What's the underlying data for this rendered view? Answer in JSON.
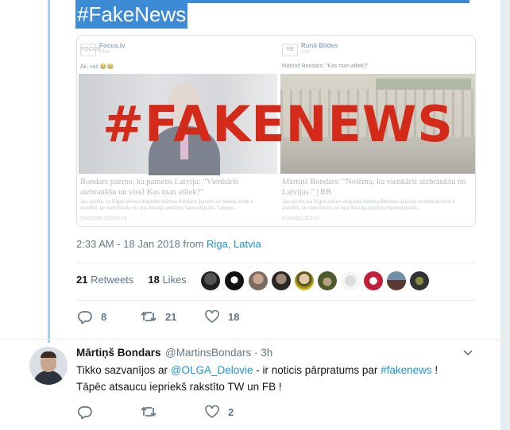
{
  "tweet_main": {
    "top_hashtag": "#FakeNews",
    "embedded_image": {
      "banner_text": "#FAKENEWS",
      "left_post": {
        "logo": "FOCUS",
        "source": "Focus.lv",
        "time": "2 hrs ·",
        "caption": "Ak, vai! 😂😂",
        "headline": "Bondars paziņo, ka pametis Latviju: \"Vienkārši aizbraukšu un viss! Kas man atliek?\"",
        "blurb": "Jau vēstīts, ka Rīgas domes deputāta Mārtiņa Bondara īpašumi un bankas konti ir aresttēti, lai nodrošinātu no viņa fiteizēju piedziņu bankrotējušās \"Latvijas...",
        "domain": "FOCUSBUSTEMS.LV"
      },
      "right_post": {
        "logo": "RB",
        "source": "Runā Bildes",
        "time": "1 hr ·",
        "caption": "Mārtiņš Bondars: \"Kas man atliek?\"",
        "headline": "Mārtiņš Bondars: \"Nolēmu, ka vienkārši aizbraukšu no Latvijas.\" | RB",
        "blurb": "Jau vēstīts, ka Rīgas domes deputāta Mārtiņa Bondara īpašumi un bankas konti ir aresttēti, lai nodrošinātu no viņa fiteizēju piedziņu bankrotējušās...",
        "domain": "RUNABILDES.LV"
      }
    },
    "timestamp": "2:33 AM - 18 Jan 2018 from ",
    "location": "Riga, Latvia",
    "retweets_count": "21",
    "retweets_label": "Retweets",
    "likes_count": "18",
    "likes_label": "Likes",
    "actions": {
      "reply_count": "8",
      "retweet_count": "21",
      "like_count": "18"
    }
  },
  "tweet_reply": {
    "name": "Mārtiņš Bondars",
    "handle": "@MartinsBondars · 3h",
    "text_1": "Tikko sazvanījos ar ",
    "mention": "@OLGA_Delovie",
    "text_2": " - ir noticis pārpratums par ",
    "hashtag": "#fakenews",
    "text_3": " !",
    "line_2": "Tāpēc atsaucu iepriekš rakstīto TW un FB !",
    "actions": {
      "reply_count": "",
      "retweet_count": "",
      "like_count": "2"
    }
  },
  "colors": {
    "accent": "#1b95e0",
    "selection": "#3d8ad5",
    "banner_red": "#d42a1a",
    "muted": "#657786",
    "thread": "#a3d3ef"
  }
}
